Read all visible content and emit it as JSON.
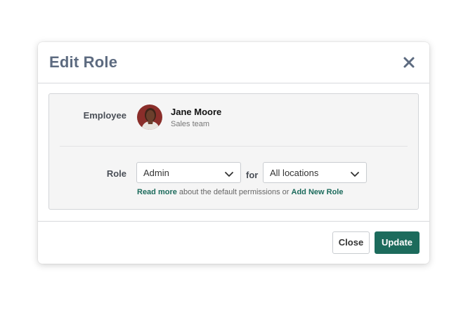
{
  "dialog": {
    "title": "Edit Role",
    "close_icon": "close-icon"
  },
  "employee": {
    "label": "Employee",
    "name": "Jane Moore",
    "team": "Sales team",
    "avatar_icon": "avatar"
  },
  "role": {
    "label": "Role",
    "selected": "Admin",
    "for_text": "for",
    "location_selected": "All locations",
    "help": {
      "read_more": "Read more",
      "middle": " about the default permissions or ",
      "add_new": "Add New Role"
    }
  },
  "footer": {
    "close_label": "Close",
    "update_label": "Update"
  },
  "colors": {
    "accent": "#1c6b5c",
    "title": "#5d6b80",
    "panel_bg": "#f5f5f5"
  }
}
